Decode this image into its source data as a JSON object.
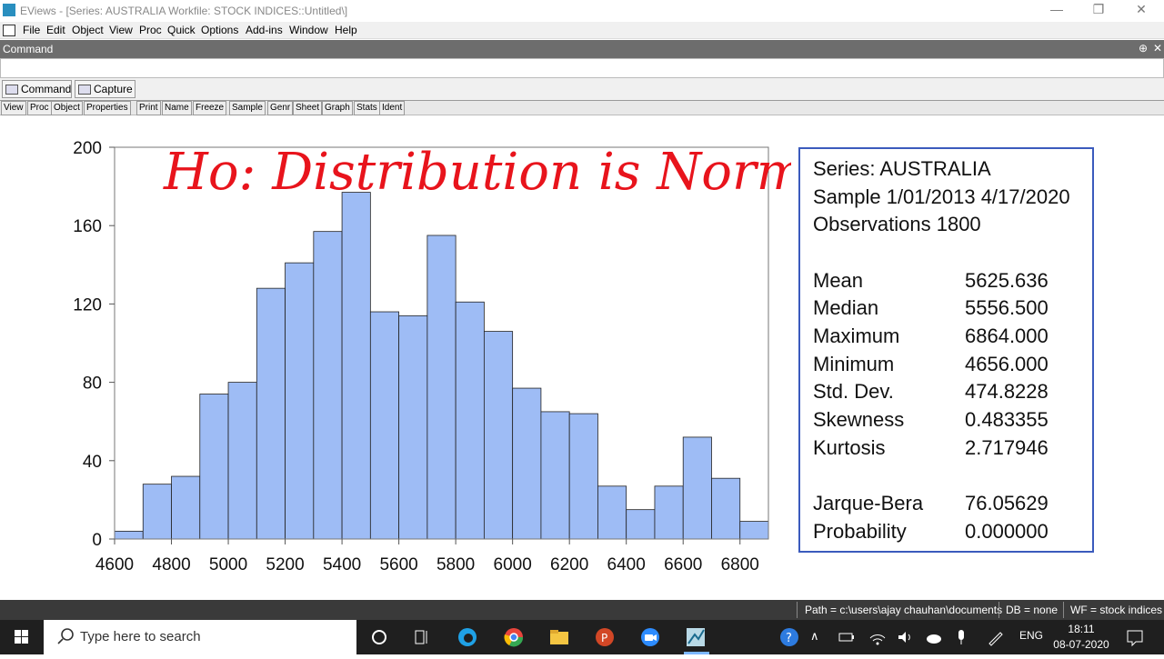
{
  "window": {
    "title": "EViews - [Series: AUSTRALIA   Workfile: STOCK INDICES::Untitled\\]",
    "minimize": "—",
    "restore": "❐",
    "close": "✕"
  },
  "menu": [
    "File",
    "Edit",
    "Object",
    "View",
    "Proc",
    "Quick",
    "Options",
    "Add-ins",
    "Window",
    "Help"
  ],
  "command": {
    "header": "Command",
    "pin": "⊕",
    "close": "✕",
    "value": "",
    "tabs": [
      "Command",
      "Capture"
    ]
  },
  "toolbar": [
    "View",
    "Proc",
    "Object",
    "Properties",
    "Print",
    "Name",
    "Freeze",
    "Sample",
    "Genr",
    "Sheet",
    "Graph",
    "Stats",
    "Ident"
  ],
  "annotation": "Ho: Distribution is Norm",
  "chart_data": {
    "type": "bar",
    "x_bins": [
      4600,
      4700,
      4800,
      4900,
      5000,
      5100,
      5200,
      5300,
      5400,
      5500,
      5600,
      5700,
      5800,
      5900,
      6000,
      6100,
      6200,
      6300,
      6400,
      6500,
      6600,
      6700,
      6800
    ],
    "bin_width": 100,
    "values": [
      4,
      28,
      32,
      74,
      80,
      128,
      141,
      157,
      177,
      116,
      114,
      155,
      121,
      106,
      77,
      65,
      64,
      27,
      15,
      27,
      52,
      31,
      9
    ],
    "x_ticks": [
      "4600",
      "4800",
      "5000",
      "5200",
      "5400",
      "5600",
      "5800",
      "6000",
      "6200",
      "6400",
      "6600",
      "6800"
    ],
    "y_ticks": [
      "0",
      "40",
      "80",
      "120",
      "160",
      "200"
    ],
    "xlim": [
      4600,
      6900
    ],
    "ylim": [
      0,
      200
    ],
    "bar_color": "#9ebcf5"
  },
  "stats": {
    "series": "Series: AUSTRALIA",
    "sample": "Sample 1/01/2013 4/17/2020",
    "observations": "Observations 1800",
    "rows": [
      {
        "label": "Mean",
        "value": "5625.636"
      },
      {
        "label": "Median",
        "value": "5556.500"
      },
      {
        "label": "Maximum",
        "value": "6864.000"
      },
      {
        "label": "Minimum",
        "value": "4656.000"
      },
      {
        "label": "Std. Dev.",
        "value": "474.8228"
      },
      {
        "label": "Skewness",
        "value": "0.483355"
      },
      {
        "label": "Kurtosis",
        "value": "2.717946"
      }
    ],
    "test_rows": [
      {
        "label": "Jarque-Bera",
        "value": "76.05629"
      },
      {
        "label": "Probability",
        "value": "0.000000"
      }
    ]
  },
  "status": {
    "path": "Path = c:\\users\\ajay chauhan\\documents",
    "db": "DB = none",
    "wf": "WF = stock indices"
  },
  "taskbar": {
    "search_placeholder": "Type here to search",
    "lang": "ENG",
    "time": "18:11",
    "date": "08-07-2020"
  }
}
